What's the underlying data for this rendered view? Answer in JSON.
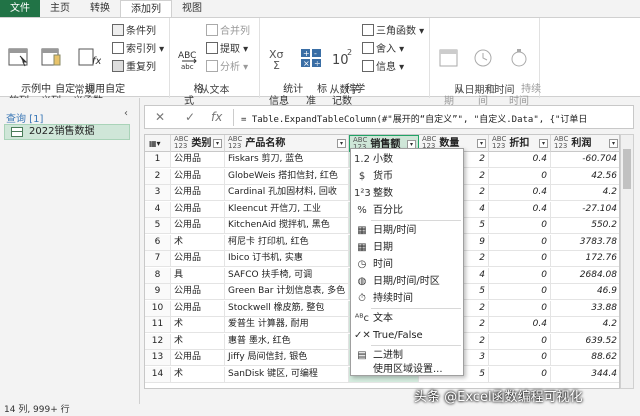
{
  "menubar": {
    "tabs": [
      "文件",
      "主页",
      "转换",
      "添加列",
      "视图"
    ],
    "active_index": 3
  },
  "ribbon": {
    "groups": {
      "general": {
        "label": "常规",
        "example_cols": "示例中\n的列",
        "custom_col": "自定\n义列",
        "invoke_custom": "调用自定\n义函数",
        "conditional": "条件列",
        "index": "索引列",
        "duplicate": "重复列"
      },
      "from_text": {
        "label": "从文本",
        "format": "格\n式",
        "merge": "合并列",
        "extract": "提取",
        "parse": "分析"
      },
      "from_number": {
        "label": "从数字",
        "stats": "统计\n信息",
        "standard": "标\n准",
        "scientific": "科学\n记数",
        "trig": "三角函数",
        "rounding": "舍入",
        "info": "信息"
      },
      "from_datetime": {
        "label": "从日期和时间",
        "date": "日\n期",
        "time": "时\n间",
        "duration": "持续\n时间"
      }
    }
  },
  "query_pane": {
    "title": "查询 [1]",
    "collapse_glyph": "‹",
    "items": [
      "2022销售数据"
    ]
  },
  "formula_bar": {
    "cancel_glyph": "✕",
    "ok_glyph": "✓",
    "fx_glyph": "fx",
    "formula": "= Table.ExpandTableColumn(#\"展开的“自定义”\", \"自定义.Data\", {\"订单日"
  },
  "grid": {
    "columns": [
      {
        "type": "ABC\n123",
        "name": "类别"
      },
      {
        "type": "ABC\n123",
        "name": "产品名称"
      },
      {
        "type": "ABC\n123",
        "name": "销售额"
      },
      {
        "type": "ABC\n123",
        "name": "数量"
      },
      {
        "type": "ABC\n123",
        "name": "折扣"
      },
      {
        "type": "ABC\n123",
        "name": "利润"
      }
    ],
    "rows": [
      {
        "n": "1",
        "cat": "公用品",
        "prod": "Fiskars 剪刀, 蓝色",
        "sales": "",
        "qty": "2",
        "disc": "0.4",
        "profit": "-60.704"
      },
      {
        "n": "2",
        "cat": "公用品",
        "prod": "GlobeWeis 搭扣信封, 红色",
        "sales": "",
        "qty": "2",
        "disc": "0",
        "profit": "42.56"
      },
      {
        "n": "3",
        "cat": "公用品",
        "prod": "Cardinal 孔加固材料, 回收",
        "sales": "",
        "qty": "2",
        "disc": "0.4",
        "profit": "4.2"
      },
      {
        "n": "4",
        "cat": "公用品",
        "prod": "Kleencut 开信刀, 工业",
        "sales": "",
        "qty": "4",
        "disc": "0.4",
        "profit": "-27.104"
      },
      {
        "n": "5",
        "cat": "公用品",
        "prod": "KitchenAid 搅拌机, 黑色",
        "sales": "",
        "qty": "5",
        "disc": "0",
        "profit": "550.2"
      },
      {
        "n": "6",
        "cat": "术",
        "prod": "柯尼卡 打印机, 红色",
        "sales": "",
        "qty": "9",
        "disc": "0",
        "profit": "3783.78"
      },
      {
        "n": "7",
        "cat": "公用品",
        "prod": "Ibico 订书机, 实惠",
        "sales": "",
        "qty": "2",
        "disc": "0",
        "profit": "172.76"
      },
      {
        "n": "8",
        "cat": "具",
        "prod": "SAFCO 扶手椅, 可调",
        "sales": "",
        "qty": "4",
        "disc": "0",
        "profit": "2684.08"
      },
      {
        "n": "9",
        "cat": "公用品",
        "prod": "Green Bar 计划信息表, 多色",
        "sales": "",
        "qty": "5",
        "disc": "0",
        "profit": "46.9"
      },
      {
        "n": "10",
        "cat": "公用品",
        "prod": "Stockwell 橡皮筋, 整包",
        "sales": "",
        "qty": "2",
        "disc": "0",
        "profit": "33.88"
      },
      {
        "n": "11",
        "cat": "术",
        "prod": "爱普生 计算器, 耐用",
        "sales": "",
        "qty": "2",
        "disc": "0.4",
        "profit": "4.2"
      },
      {
        "n": "12",
        "cat": "术",
        "prod": "惠普 墨水, 红色",
        "sales": "",
        "qty": "2",
        "disc": "0",
        "profit": "639.52"
      },
      {
        "n": "13",
        "cat": "公用品",
        "prod": "Jiffy 局间信封, 银色",
        "sales": "",
        "qty": "3",
        "disc": "0",
        "profit": "88.62"
      },
      {
        "n": "14",
        "cat": "术",
        "prod": "SanDisk 键区, 可编程",
        "sales": "1326.5",
        "qty": "5",
        "disc": "0",
        "profit": "344.4"
      }
    ]
  },
  "type_menu": {
    "items": [
      {
        "icon": "1.2",
        "label": "小数"
      },
      {
        "icon": "$",
        "label": "货币"
      },
      {
        "icon": "1²3",
        "label": "整数"
      },
      {
        "icon": "%",
        "label": "百分比"
      },
      {
        "icon": "▦",
        "label": "日期/时间"
      },
      {
        "icon": "▦",
        "label": "日期"
      },
      {
        "icon": "◷",
        "label": "时间"
      },
      {
        "icon": "◍",
        "label": "日期/时间/时区"
      },
      {
        "icon": "⏱",
        "label": "持续时间"
      },
      {
        "icon": "ᴬᴮc",
        "label": "文本"
      },
      {
        "icon": "✓✕",
        "label": "True/False"
      },
      {
        "icon": "▤",
        "label": "二进制"
      },
      {
        "icon": "",
        "label": "使用区域设置..."
      }
    ]
  },
  "status": {
    "text": "14 列, 999+ 行"
  },
  "watermark": {
    "text": "头条 @Excel函数编程可视化"
  },
  "colors": {
    "accent": "#217346",
    "selection": "#cfe6d8"
  }
}
